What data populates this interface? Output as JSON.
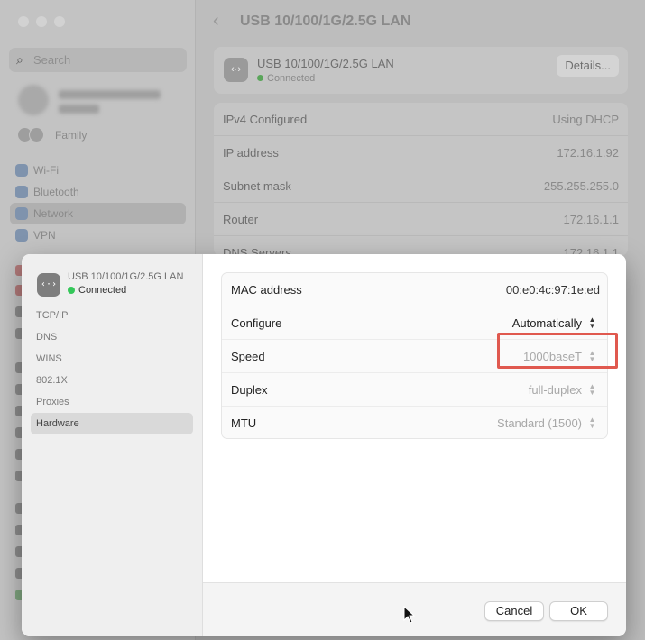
{
  "background": {
    "search_placeholder": "Search",
    "family_label": "Family",
    "sidebar_items": [
      {
        "label": "Wi-Fi",
        "icon": "wifi-icon"
      },
      {
        "label": "Bluetooth",
        "icon": "bluetooth-icon"
      },
      {
        "label": "Network",
        "icon": "network-icon",
        "selected": true
      },
      {
        "label": "VPN",
        "icon": "vpn-icon"
      }
    ],
    "header_title": "USB 10/100/1G/2.5G LAN",
    "interface_card": {
      "name": "USB 10/100/1G/2.5G LAN",
      "status": "Connected",
      "details_button": "Details..."
    },
    "info_rows": [
      {
        "key": "IPv4 Configured",
        "value": "Using DHCP"
      },
      {
        "key": "IP address",
        "value": "172.16.1.92"
      },
      {
        "key": "Subnet mask",
        "value": "255.255.255.0"
      },
      {
        "key": "Router",
        "value": "172.16.1.1"
      },
      {
        "key": "DNS Servers",
        "value": "172.16.1.1"
      }
    ]
  },
  "dialog": {
    "interface_name": "USB 10/100/1G/2.5G LAN",
    "interface_status": "Connected",
    "tabs": [
      {
        "label": "TCP/IP"
      },
      {
        "label": "DNS"
      },
      {
        "label": "WINS"
      },
      {
        "label": "802.1X"
      },
      {
        "label": "Proxies"
      },
      {
        "label": "Hardware",
        "selected": true
      }
    ],
    "rows": [
      {
        "key": "MAC address",
        "value": "00:e0:4c:97:1e:ed"
      },
      {
        "key": "Configure",
        "value": "Automatically"
      },
      {
        "key": "Speed",
        "value": "1000baseT"
      },
      {
        "key": "Duplex",
        "value": "full-duplex"
      },
      {
        "key": "MTU",
        "value": "Standard (1500)"
      }
    ],
    "cancel_label": "Cancel",
    "ok_label": "OK"
  },
  "colors": {
    "status_green": "#34c759",
    "highlight": "#e0594f"
  }
}
